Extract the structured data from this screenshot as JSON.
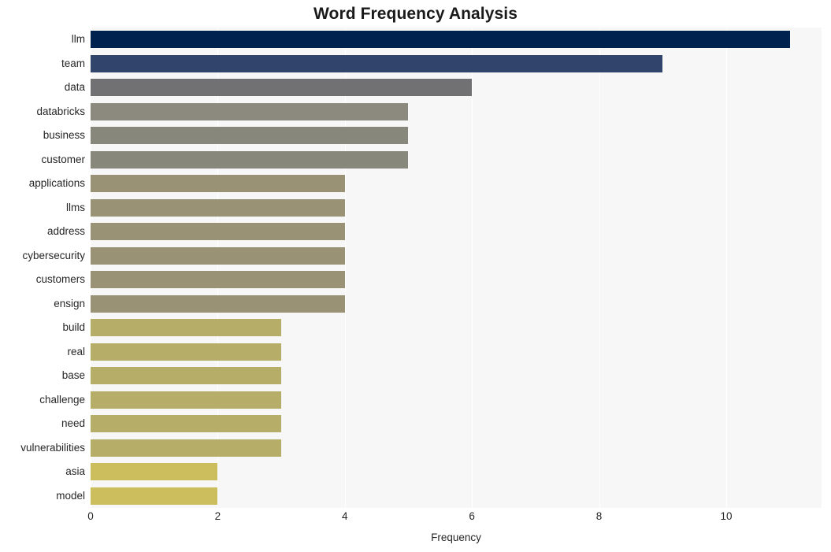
{
  "chart_data": {
    "type": "bar",
    "orientation": "horizontal",
    "title": "Word Frequency Analysis",
    "xlabel": "Frequency",
    "ylabel": "",
    "categories": [
      "llm",
      "team",
      "data",
      "databricks",
      "business",
      "customer",
      "applications",
      "llms",
      "address",
      "cybersecurity",
      "customers",
      "ensign",
      "build",
      "real",
      "base",
      "challenge",
      "need",
      "vulnerabilities",
      "asia",
      "model"
    ],
    "values": [
      11,
      9,
      6,
      5,
      5,
      5,
      4,
      4,
      4,
      4,
      4,
      4,
      3,
      3,
      3,
      3,
      3,
      3,
      2,
      2
    ],
    "bar_colors": [
      "#00224e",
      "#31446b",
      "#717072",
      "#8c8a7f",
      "#88877c",
      "#88877c",
      "#9a9274",
      "#9a9274",
      "#9a9274",
      "#9a9274",
      "#9a9274",
      "#9a9274",
      "#b6ad69",
      "#b6ad69",
      "#b6ad69",
      "#b6ad69",
      "#b6ad69",
      "#b6ad69",
      "#cdbe5d",
      "#cdbe5d"
    ],
    "xlim": [
      0,
      11.5
    ],
    "xticks": [
      0,
      2,
      4,
      6,
      8,
      10
    ],
    "xtick_labels": [
      "0",
      "2",
      "4",
      "6",
      "8",
      "10"
    ],
    "grid": true,
    "grid_axis": "x",
    "grid_color": "#ffffff",
    "plot_background": "#f7f7f7",
    "figure_background": "#ffffff",
    "legend": null
  }
}
